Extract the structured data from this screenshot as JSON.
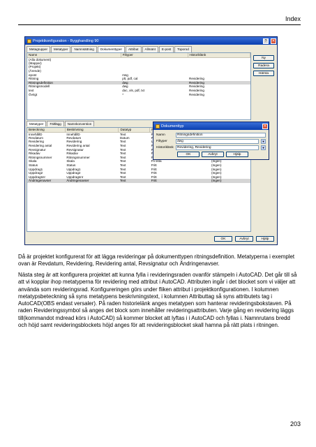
{
  "header": {
    "title": "Index"
  },
  "page_number": "203",
  "dialog": {
    "title": "Projektkonfiguration - Bygghandling 90",
    "tabs": [
      "Metagrupper",
      "Metatyper",
      "Namnsättning",
      "Dokumenttyper",
      "Attribut",
      "Allmänt",
      "E-post",
      "Toporod"
    ],
    "columns": [
      "Namn",
      "Filtyper",
      "Historiklänk"
    ],
    "rows": [
      [
        "(Alla dokument)",
        "",
        ""
      ],
      [
        "(Mappar)",
        "",
        ""
      ],
      [
        "(Projekt)",
        "",
        ""
      ],
      [
        "(Ärende)",
        "",
        ""
      ],
      [
        "epost",
        "msg",
        ""
      ],
      [
        "Ritning",
        "plt, pdf, cal",
        "Revidering"
      ],
      [
        "Ritningsdefinition",
        "dwg",
        "Revidering"
      ],
      [
        "Ritningsmodell",
        "dwg",
        "Revidering"
      ],
      [
        "text",
        "doc, xls, pdf, txt",
        "Revidering"
      ],
      [
        "Övrigt",
        "*",
        "Revidering"
      ]
    ],
    "side_buttons": [
      "Ny",
      "Radera",
      "Hämta"
    ],
    "lower_tabs": [
      "Metatyper",
      "Fältlägg",
      "Namnkonvention"
    ],
    "lower_columns": [
      "Beteckning",
      "Beskrivning",
      "Datatyp",
      "Redigera"
    ],
    "lower_rows": [
      [
        "InnehållD",
        "InnehållD",
        "Text",
        "Fritt",
        ""
      ],
      [
        "Revdatum",
        "Revdatum",
        "Datum",
        "Fritt",
        ""
      ],
      [
        "Revidering",
        "Revidering",
        "Text",
        "Lista",
        ""
      ],
      [
        "Revidering antal",
        "Revidering antal",
        "Text",
        "Fritt",
        "(Ingen)"
      ],
      [
        "Revsignatur",
        "Revsignatur",
        "Text",
        "Fritt",
        "(Ingen)"
      ],
      [
        "Rikadav",
        "Rikadav",
        "Text",
        "Fritt",
        "(Ingen)"
      ],
      [
        "Ritningsnummer",
        "Ritningsnummer",
        "Text",
        "Filnamn",
        "(Ingen)"
      ],
      [
        "Skala",
        "Skala",
        "Text",
        "Fri lista",
        "(Ingen)"
      ],
      [
        "Status",
        "Status",
        "Text",
        "Fritt",
        "(Ingen)"
      ],
      [
        "Uppdrag1",
        "Uppdrag1",
        "Text",
        "Fritt",
        "(Ingen)"
      ],
      [
        "Uppdrag2",
        "Uppdrag2",
        "Text",
        "Fritt",
        "(Ingen)"
      ],
      [
        "Uppdragsnr",
        "Uppdragsnr",
        "Text",
        "Fritt",
        "(Ingen)"
      ],
      [
        "Ändringenavser",
        "Ändringenavser",
        "Text",
        "Fritt",
        "(Ingen)"
      ]
    ],
    "bottom_buttons": [
      "OK",
      "Avbryt",
      "Hjälp"
    ]
  },
  "subdialog": {
    "title": "Dokumenttyp",
    "name_label": "Namn",
    "name_value": "Ritningsdefinition",
    "filetypes_label": "Filtyper",
    "filetypes_value": "dwg",
    "history_label": "Historiklänk",
    "history_value": "Revidering, Revidering",
    "buttons": [
      "OK",
      "Avbryt",
      "Hjälp"
    ]
  },
  "body": {
    "p1": "Då är projektet konfigurerat för att lägga revideringar på dokumenttypen ritningsdefinition. Metatyperna i exemplet ovan är Revdatum, Revidering, Revidering antal, Revsignatur och Ändringenavser.",
    "p2": "Nästa steg är att konfigurera projektet att kunna fylla i revideringsraden ovanför stämpeln i AutoCAD. Det går till så att vi kopplar ihop metatyperna för revidering med attribut i AutoCAD. Attributen ingår i det blocket som vi väljer att använda som revideringsrad. Konfigureringen görs under fliken attribut i projektkonfigurationen. I kolumnen metatypsbeteckning så syns metatypens beskrivningstext, i kolumnen Attributtag så syns attributets tag i AutoCAD(OBS endast versaler). På raden historielänk anges metatypen som hanterar revideringsbokstaven. På raden Revideringssymbol så anges det block som innehåller revideringsattributen. Varje gång en revidering läggs till(kommandot mdread körs i AutoCAD) så kommer blocket att lyftas i i AutoCAD och fyllas i. Namnrutans bredd och höjd samt revideringsblockets höjd anges för att revideringsblocket skall hamna på rätt plats i ritningen."
  }
}
